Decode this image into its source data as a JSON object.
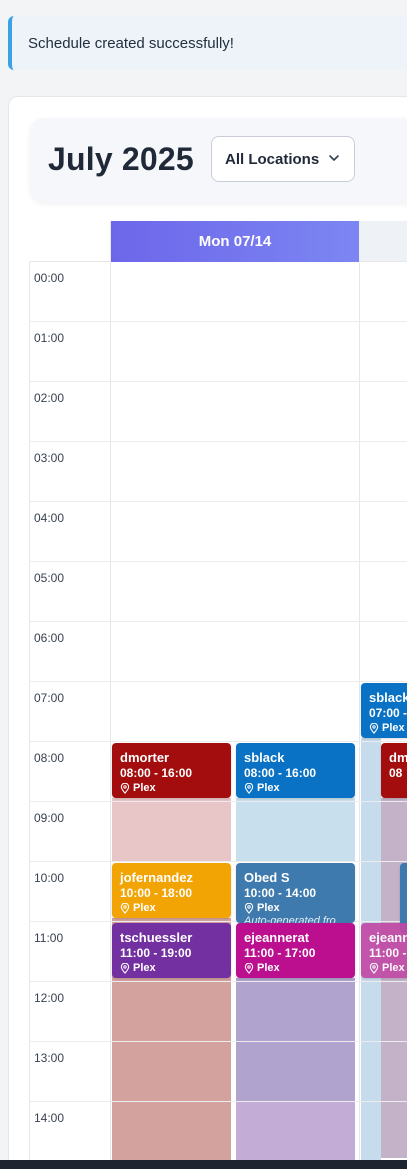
{
  "alert": {
    "message": "Schedule created successfully!"
  },
  "header": {
    "title": "July 2025",
    "location_select": "All Locations"
  },
  "calendar": {
    "day_header": "Mon 07/14",
    "hours": [
      "00:00",
      "01:00",
      "02:00",
      "03:00",
      "04:00",
      "05:00",
      "06:00",
      "07:00",
      "08:00",
      "09:00",
      "10:00",
      "11:00",
      "12:00",
      "13:00",
      "14:00"
    ]
  },
  "shifts": [
    {
      "name": "dmorter",
      "time": "08:00 - 16:00",
      "location": "Plex",
      "color": "#a30d0d"
    },
    {
      "name": "sblack",
      "time": "08:00 - 16:00",
      "location": "Plex",
      "color": "#0a72c4"
    },
    {
      "name": "jofernandez",
      "time": "10:00 - 18:00",
      "location": "Plex",
      "color": "#f2a405"
    },
    {
      "name": "Obed S",
      "time": "10:00 - 14:00",
      "location": "Plex",
      "note": "Auto-generated fro",
      "color": "#3e7aad"
    },
    {
      "name": "tschuessler",
      "time": "11:00 - 19:00",
      "location": "Plex",
      "color": "#7330a0"
    },
    {
      "name": "ejeannerat",
      "time": "11:00 - 17:00",
      "location": "Plex",
      "color": "#bb0f8f"
    },
    {
      "name": "sblack",
      "time": "07:00 -",
      "location": "Plex",
      "color": "#0a72c4"
    },
    {
      "name": "dm",
      "time": "08",
      "location": "",
      "color": "#a30d0d"
    },
    {
      "name": "ejeann",
      "time": "11:00 -",
      "location": "Plex",
      "color": "#bb0f8f"
    }
  ]
}
